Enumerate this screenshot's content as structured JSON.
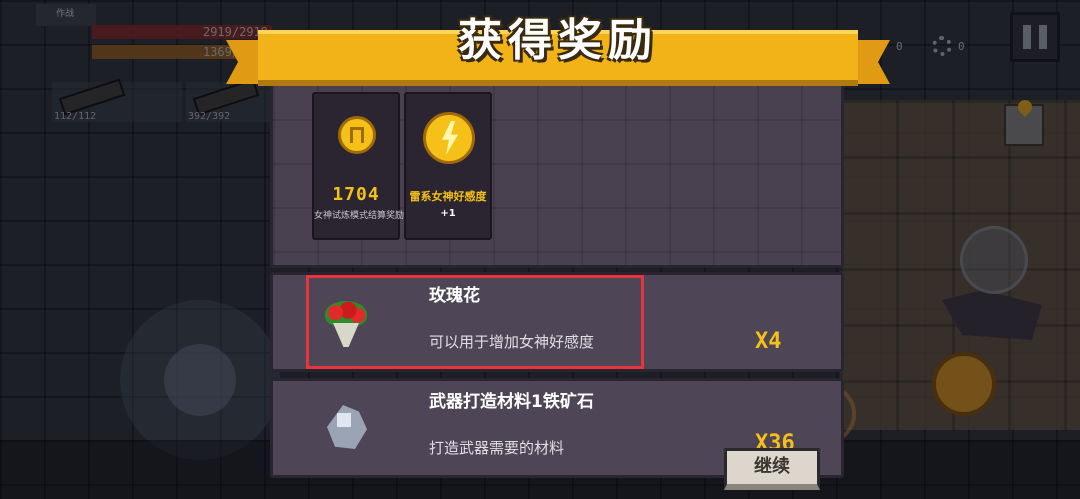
{
  "hud": {
    "level": "作战",
    "hp": "2919/2919",
    "shield": "1369/1369",
    "weapon1_ammo": "112/112",
    "weapon2_ammo": "392/392"
  },
  "reward_dialog": {
    "title": "获得奖励",
    "cards": [
      {
        "icon": "coin-icon",
        "amount": "1704",
        "desc": "女神试炼模式结算奖励+1704"
      },
      {
        "icon": "lightning-icon",
        "name": "雷系女神好感度",
        "amount": "+1"
      }
    ],
    "items": [
      {
        "icon": "rose-bouquet-icon",
        "title": "玫瑰花",
        "desc": "可以用于增加女神好感度",
        "qty": "X4"
      },
      {
        "icon": "iron-ore-icon",
        "title": "武器打造材料1铁矿石",
        "desc": "打造武器需要的材料",
        "qty": "X36"
      }
    ],
    "continue_label": "继续"
  },
  "colors": {
    "banner": "#f2b318",
    "accent_gold": "#f5c018",
    "highlight": "#e8343a"
  }
}
